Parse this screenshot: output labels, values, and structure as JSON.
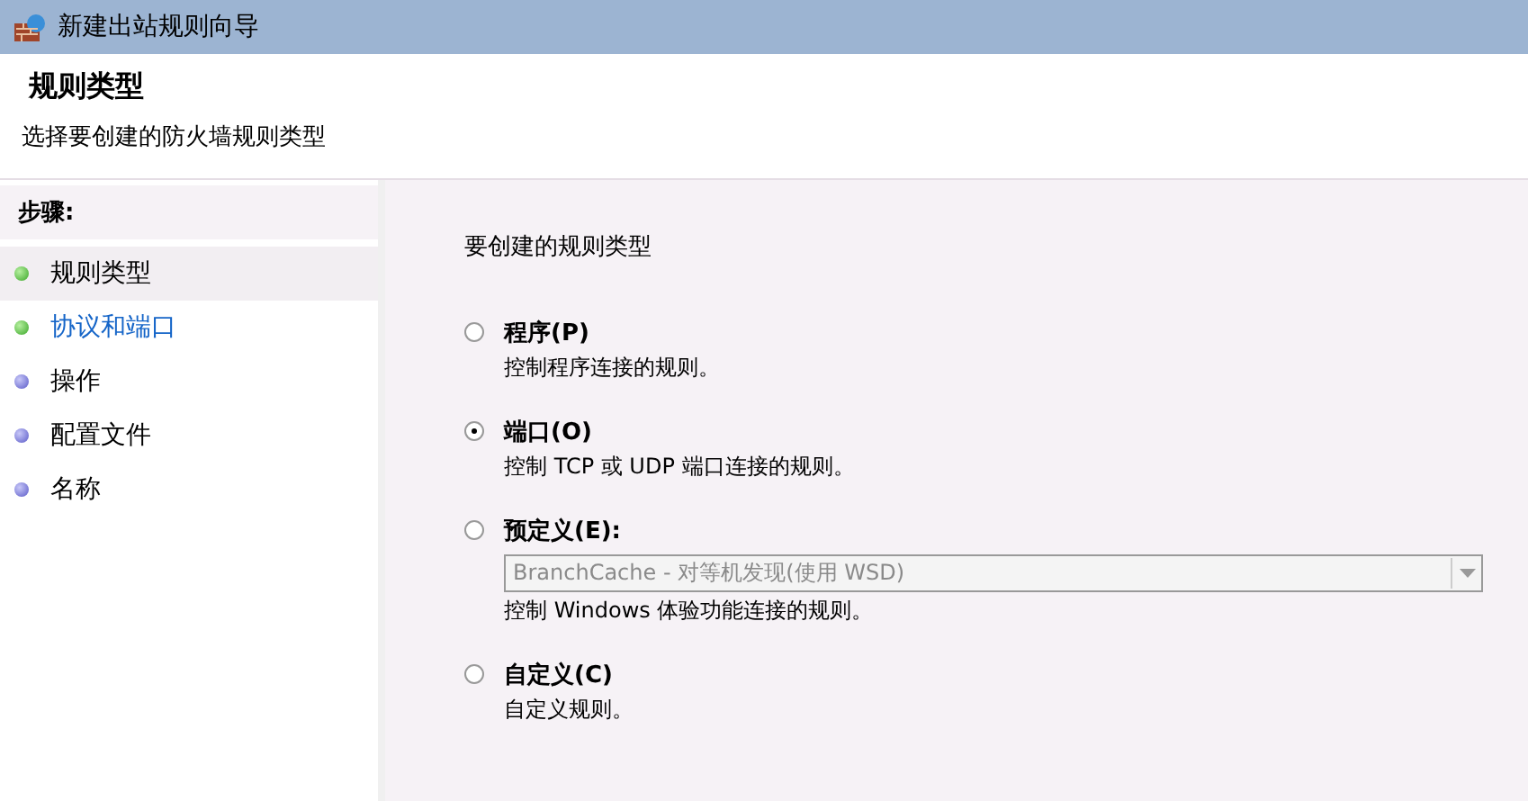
{
  "window": {
    "title": "新建出站规则向导"
  },
  "header": {
    "title": "规则类型",
    "subtitle": "选择要创建的防火墙规则类型"
  },
  "steps": {
    "heading": "步骤:",
    "items": [
      {
        "label": "规则类型",
        "done": true,
        "selected": true,
        "link": false
      },
      {
        "label": "协议和端口",
        "done": true,
        "selected": false,
        "link": true
      },
      {
        "label": "操作",
        "done": false,
        "selected": false,
        "link": false
      },
      {
        "label": "配置文件",
        "done": false,
        "selected": false,
        "link": false
      },
      {
        "label": "名称",
        "done": false,
        "selected": false,
        "link": false
      }
    ]
  },
  "content": {
    "prompt": "要创建的规则类型",
    "options": [
      {
        "label": "程序(P)",
        "description": "控制程序连接的规则。",
        "selected": false
      },
      {
        "label": "端口(O)",
        "description": "控制 TCP 或 UDP 端口连接的规则。",
        "selected": true
      },
      {
        "label": "预定义(E):",
        "description": "控制 Windows 体验功能连接的规则。",
        "selected": false,
        "dropdown": {
          "value": "BranchCache - 对等机发现(使用 WSD)",
          "disabled": true
        }
      },
      {
        "label": "自定义(C)",
        "description": "自定义规则。",
        "selected": false
      }
    ]
  }
}
